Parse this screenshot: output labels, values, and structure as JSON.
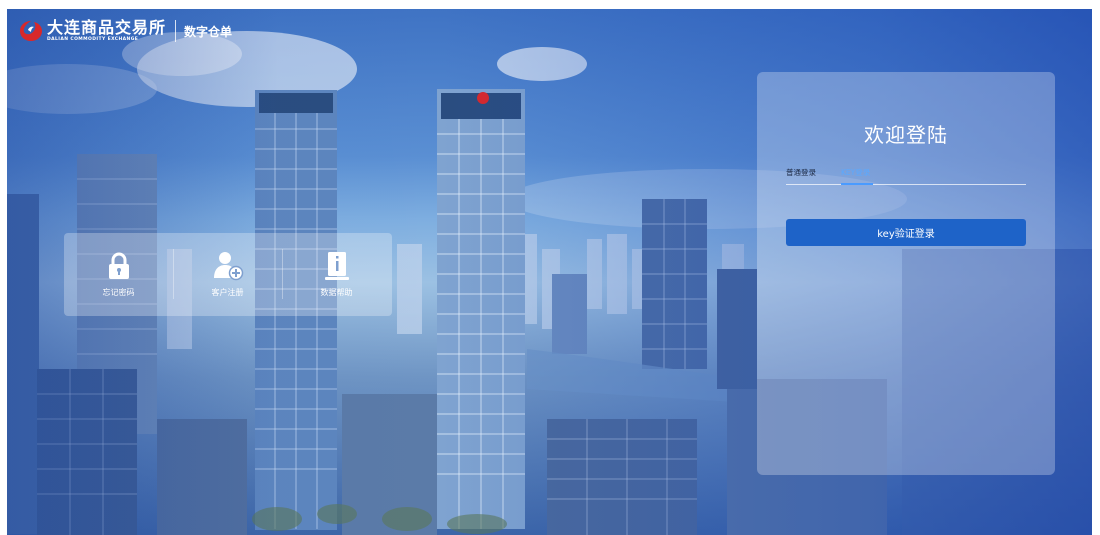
{
  "header": {
    "brand_cn": "大连商品交易所",
    "brand_en": "DALIAN COMMODITY EXCHANGE",
    "subtitle": "数字仓单"
  },
  "quick_actions": [
    {
      "label": "忘记密码",
      "icon": "lock-icon"
    },
    {
      "label": "客户注册",
      "icon": "user-add-icon"
    },
    {
      "label": "数据帮助",
      "icon": "info-document-icon"
    }
  ],
  "login": {
    "title": "欢迎登陆",
    "tabs": [
      {
        "label": "普通登录",
        "active": false
      },
      {
        "label": "KEY登录",
        "active": true
      }
    ],
    "button_label": "key验证登录"
  },
  "colors": {
    "primary_button": "#1e63c8",
    "active_tab": "#4a9bff",
    "brand_red": "#d8282b"
  }
}
